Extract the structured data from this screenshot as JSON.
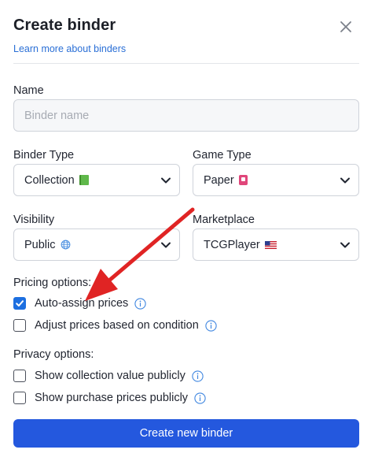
{
  "dialog": {
    "title": "Create binder",
    "learn_more": "Learn more about binders",
    "close_icon": "close-icon"
  },
  "name_field": {
    "label": "Name",
    "placeholder": "Binder name",
    "value": ""
  },
  "binder_type": {
    "label": "Binder Type",
    "value": "Collection",
    "icon": "green-book-emoji"
  },
  "game_type": {
    "label": "Game Type",
    "value": "Paper",
    "icon": "pink-card-emoji"
  },
  "visibility": {
    "label": "Visibility",
    "value": "Public",
    "icon": "globe-icon"
  },
  "marketplace": {
    "label": "Marketplace",
    "value": "TCGPlayer",
    "icon": "us-flag-emoji"
  },
  "pricing": {
    "title": "Pricing options:",
    "options": [
      {
        "label": "Auto-assign prices",
        "checked": true
      },
      {
        "label": "Adjust prices based on condition",
        "checked": false
      }
    ]
  },
  "privacy": {
    "title": "Privacy options:",
    "options": [
      {
        "label": "Show collection value publicly",
        "checked": false
      },
      {
        "label": "Show purchase prices publicly",
        "checked": false
      }
    ]
  },
  "submit_label": "Create new binder",
  "colors": {
    "primary": "#2458de",
    "checkbox_checked": "#1d6fe0",
    "link": "#2a6fd6",
    "annotation_arrow": "#e02424",
    "info_icon": "#3f86e0"
  }
}
